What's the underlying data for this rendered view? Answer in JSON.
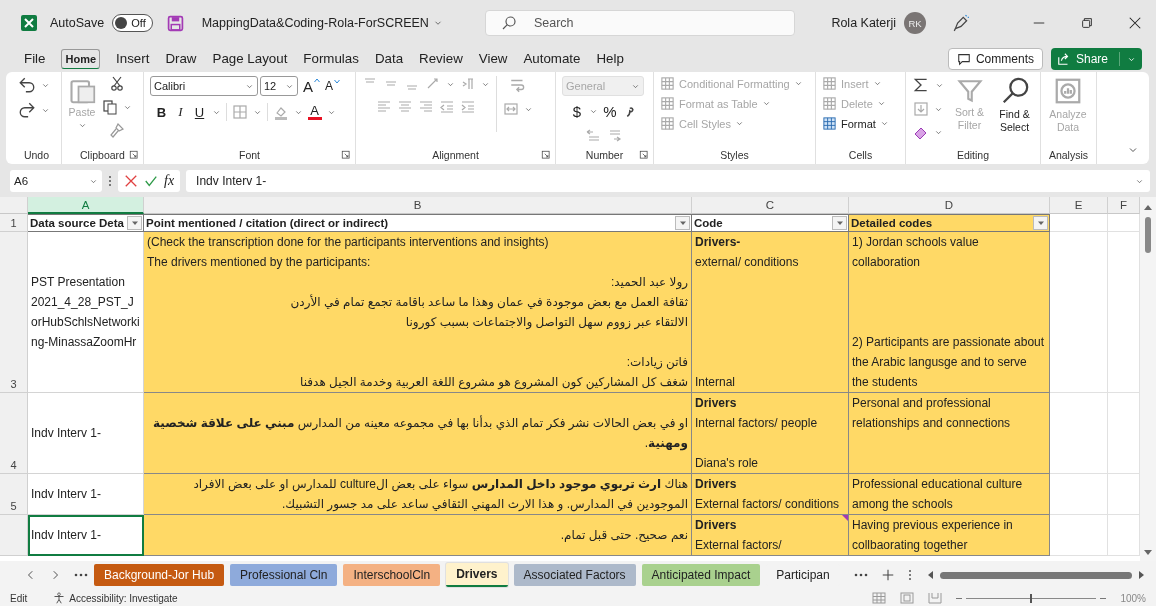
{
  "title_bar": {
    "autosave_label": "AutoSave",
    "autosave_state": "Off",
    "autosave_on": false,
    "file_name": "MappingData&Coding-Rola-ForSCREEN",
    "search_placeholder": "Search",
    "user_name": "Rola Katerji",
    "user_initials": "RK"
  },
  "menu_tabs": [
    {
      "label": "File",
      "selected": false
    },
    {
      "label": "Home",
      "selected": true
    },
    {
      "label": "Insert",
      "selected": false
    },
    {
      "label": "Draw",
      "selected": false
    },
    {
      "label": "Page Layout",
      "selected": false
    },
    {
      "label": "Formulas",
      "selected": false
    },
    {
      "label": "Data",
      "selected": false
    },
    {
      "label": "Review",
      "selected": false
    },
    {
      "label": "View",
      "selected": false
    },
    {
      "label": "Automate",
      "selected": false
    },
    {
      "label": "Help",
      "selected": false
    }
  ],
  "comments_button": "Comments",
  "share_button": "Share",
  "ribbon": {
    "groups": [
      {
        "kind": "undo",
        "label": "Undo",
        "launcher": false
      },
      {
        "kind": "clipboard",
        "label": "Clipboard",
        "launcher": true,
        "paste": {
          "label": "Paste",
          "disabled": true
        }
      },
      {
        "kind": "font",
        "label": "Font",
        "launcher": true,
        "font_name": "Calibri",
        "font_size": "12",
        "grow": "A",
        "shrink": "A",
        "bold": "B",
        "italic": "I",
        "underline": "U",
        "font_color_letter": "A"
      },
      {
        "kind": "alignment",
        "label": "Alignment",
        "launcher": true
      },
      {
        "kind": "number",
        "label": "Number",
        "launcher": true,
        "format": "General",
        "format_disabled": true,
        "currency": "$",
        "percent": "%"
      },
      {
        "kind": "styles",
        "label": "Styles",
        "launcher": false,
        "items": [
          {
            "label": "Conditional Formatting",
            "disabled": true
          },
          {
            "label": "Format as Table",
            "disabled": true
          },
          {
            "label": "Cell Styles",
            "disabled": true
          }
        ]
      },
      {
        "kind": "cells",
        "label": "Cells",
        "launcher": false,
        "items": [
          {
            "label": "Insert",
            "disabled": true
          },
          {
            "label": "Delete",
            "disabled": true
          },
          {
            "label": "Format",
            "disabled": false
          }
        ]
      },
      {
        "kind": "editing",
        "label": "Editing",
        "launcher": false,
        "sort_filter": {
          "label": "Sort & Filter",
          "disabled": true
        },
        "find_select": {
          "label": "Find & Select",
          "disabled": false
        }
      },
      {
        "kind": "analysis",
        "label": "Analysis",
        "launcher": false,
        "analyze": {
          "label": "Analyze Data",
          "disabled": true
        }
      }
    ]
  },
  "formula_bar": {
    "name_box": "A6",
    "function_label": "fx",
    "formula": "Indv Interv 1-"
  },
  "sheet": {
    "columns": [
      {
        "letter": "A",
        "selected": true
      },
      {
        "letter": "B",
        "selected": false
      },
      {
        "letter": "C",
        "selected": false
      },
      {
        "letter": "D",
        "selected": false
      },
      {
        "letter": "E",
        "selected": false
      },
      {
        "letter": "F",
        "selected": false
      }
    ],
    "header_row": {
      "number": "1",
      "cells": [
        {
          "text": "Data source Deta",
          "highlight": false
        },
        {
          "text": "Point mentioned / citation (direct or indirect)",
          "highlight": false
        },
        {
          "text": "Code",
          "highlight": false
        },
        {
          "text": "Detailed codes",
          "highlight": true
        }
      ]
    },
    "rows": [
      {
        "number": "3",
        "cells": [
          {
            "paragraphs": [
              [
                "PST Presentation 2021_4_28_PST_JorHubSchlsNetworking-MinassaZoomHr"
              ]
            ],
            "highlight": false,
            "active": false,
            "note": false
          },
          {
            "paragraphs": [
              [
                "(Check the transcription done for the participants interventions and insights)",
                "The drivers mentioned by the participants:",
                "رولا عبد الحميد:",
                "ثقافة العمل مع بعض موجودة في عمان وهذا ما ساعد باقامة تجمع تمام في الأردن",
                "الالتقاء عبر زووم سهل التواصل والاجتماعات بسبب كورونا"
              ],
              [
                "فاتن زيادات:",
                "شغف كل المشاركين كون المشروع هو مشروع اللغة العربية وخدمة الجيل هدفنا"
              ]
            ],
            "highlight": true,
            "active": false,
            "note": false
          },
          {
            "paragraphs": [
              [
                "**Drivers-**",
                "external/ conditions"
              ],
              [
                "Internal"
              ]
            ],
            "highlight": true,
            "active": false,
            "note": false
          },
          {
            "paragraphs": [
              [
                "1) Jordan schools value collaboration"
              ],
              [
                "2) Participants are passionate about the Arabic langusge and to serve the students"
              ]
            ],
            "highlight": true,
            "active": false,
            "note": false
          }
        ]
      },
      {
        "number": "4",
        "cells": [
          {
            "paragraphs": [
              [
                "Indv Interv 1-"
              ]
            ],
            "highlight": false,
            "active": false,
            "note": false
          },
          {
            "paragraphs": [
              [
                "او في بعض الحالات نشر فكر تمام الذي بدأنا بها في مجموعه معينه من المدارس **مبني على علاقة شخصية ومهنية**."
              ]
            ],
            "highlight": true,
            "active": false,
            "note": false
          },
          {
            "paragraphs": [
              [
                "**Drivers**",
                "Internal factors/ people"
              ],
              [
                "Diana's role"
              ]
            ],
            "highlight": true,
            "active": false,
            "note": false
          },
          {
            "paragraphs": [
              [
                "Personal and professional relationships and connections"
              ]
            ],
            "highlight": true,
            "active": false,
            "note": false
          }
        ]
      },
      {
        "number": "5",
        "cells": [
          {
            "paragraphs": [
              [
                "Indv Interv 1-"
              ]
            ],
            "highlight": false,
            "active": false,
            "note": false
          },
          {
            "paragraphs": [
              [
                "هناك **ارث تربوي موجود داخل المدارس** سواء على بعض الculture للمدارس او على بعض الافراد الموجودين في المدارس. و هذا الارث المهني الثقافي ساعد على مد جسور التشبيك."
              ]
            ],
            "highlight": true,
            "active": false,
            "note": false
          },
          {
            "paragraphs": [
              [
                "**Drivers**",
                "External factors/ conditions"
              ]
            ],
            "highlight": true,
            "active": false,
            "note": false
          },
          {
            "paragraphs": [
              [
                "Professional educational culture among the schools"
              ]
            ],
            "highlight": true,
            "active": false,
            "note": false
          }
        ]
      },
      {
        "cells": [
          {
            "paragraphs": [
              [
                "Indv Interv 1-"
              ]
            ],
            "highlight": false,
            "active": true,
            "note": false
          },
          {
            "paragraphs": [
              [
                "نعم صحيح. حتى قبل تمام."
              ]
            ],
            "highlight": true,
            "active": false,
            "note": false
          },
          {
            "paragraphs": [
              [
                "**Drivers**",
                "External factors/"
              ]
            ],
            "highlight": true,
            "active": false,
            "note": true
          },
          {
            "paragraphs": [
              [
                "Having previous experience in collbaorating together"
              ]
            ],
            "highlight": true,
            "active": false,
            "note": false
          }
        ]
      }
    ]
  },
  "sheet_tabs": [
    {
      "label": "Background-Jor Hub",
      "color": "#c55a11",
      "selected": false
    },
    {
      "label": "Professional Cln",
      "color": "#8eaadb",
      "selected": false
    },
    {
      "label": "InterschoolCln",
      "color": "#f4b183",
      "selected": false
    },
    {
      "label": "Drivers",
      "color": "#fff2cc",
      "selected": true
    },
    {
      "label": "Associated Factors",
      "color": "#adb9ca",
      "selected": false
    },
    {
      "label": "Anticipated Impact",
      "color": "#a9d18e",
      "selected": false
    },
    {
      "label": "Participan",
      "color": "#f3f3f3",
      "selected": false
    }
  ],
  "status_bar": {
    "mode": "Edit",
    "accessibility": "Accessibility: Investigate",
    "zoom_slider": {
      "level": 0.5
    },
    "zoom": "100%"
  }
}
